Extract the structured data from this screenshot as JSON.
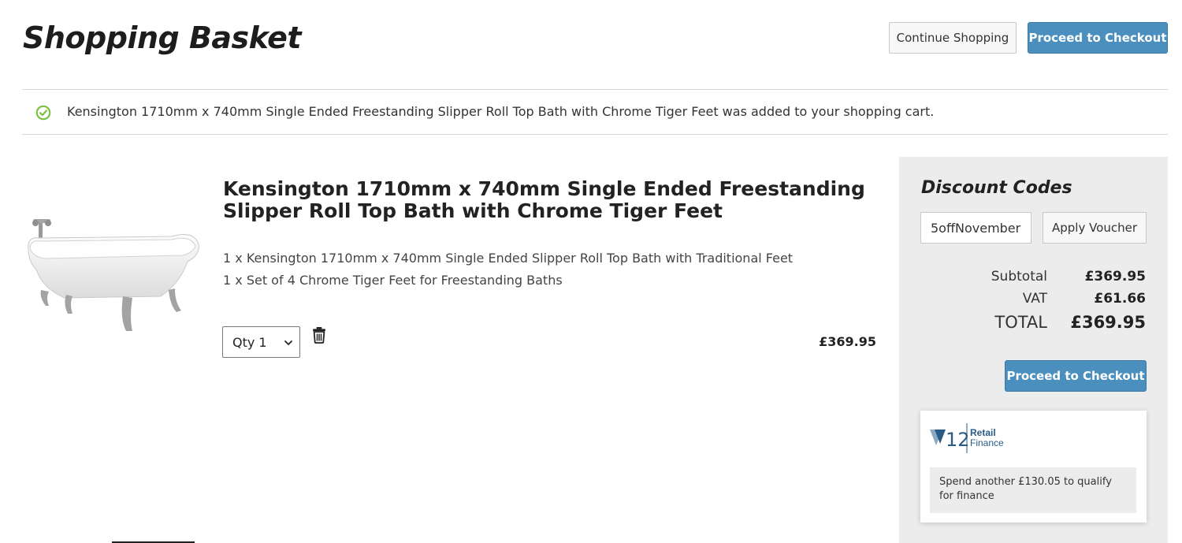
{
  "header": {
    "title": "Shopping Basket",
    "continue_label": "Continue Shopping",
    "checkout_label": "Proceed to Checkout"
  },
  "notice": {
    "icon": "check-circle-icon",
    "icon_color": "#7cc142",
    "text": "Kensington 1710mm x 740mm Single Ended Freestanding Slipper Roll Top Bath with Chrome Tiger Feet was added to your shopping cart."
  },
  "item": {
    "image_alt": "freestanding-slipper-bath-image",
    "title": "Kensington 1710mm x 740mm Single Ended Freestanding Slipper Roll Top Bath with Chrome Tiger Feet",
    "components": [
      "1 x Kensington 1710mm x 740mm Single Ended Slipper Roll Top Bath with Traditional Feet",
      "1 x Set of 4 Chrome Tiger Feet for Freestanding Baths"
    ],
    "qty_label": "Qty 1",
    "price": "£369.95"
  },
  "summary": {
    "discount_heading": "Discount Codes",
    "voucher_value": "5offNovember",
    "apply_label": "Apply Voucher",
    "subtotal_label": "Subtotal",
    "subtotal_value": "£369.95",
    "vat_label": "VAT",
    "vat_value": "£61.66",
    "total_label": "TOTAL",
    "total_value": "£369.95",
    "checkout_label": "Proceed to Checkout"
  },
  "finance": {
    "logo_mark": "V12",
    "logo_line1": "Retail",
    "logo_line2": "Finance",
    "message": "Spend another £130.05 to qualify for finance"
  },
  "colors": {
    "accent": "#4a8fbe",
    "panel_bg": "#ececec",
    "success": "#7cc142"
  }
}
